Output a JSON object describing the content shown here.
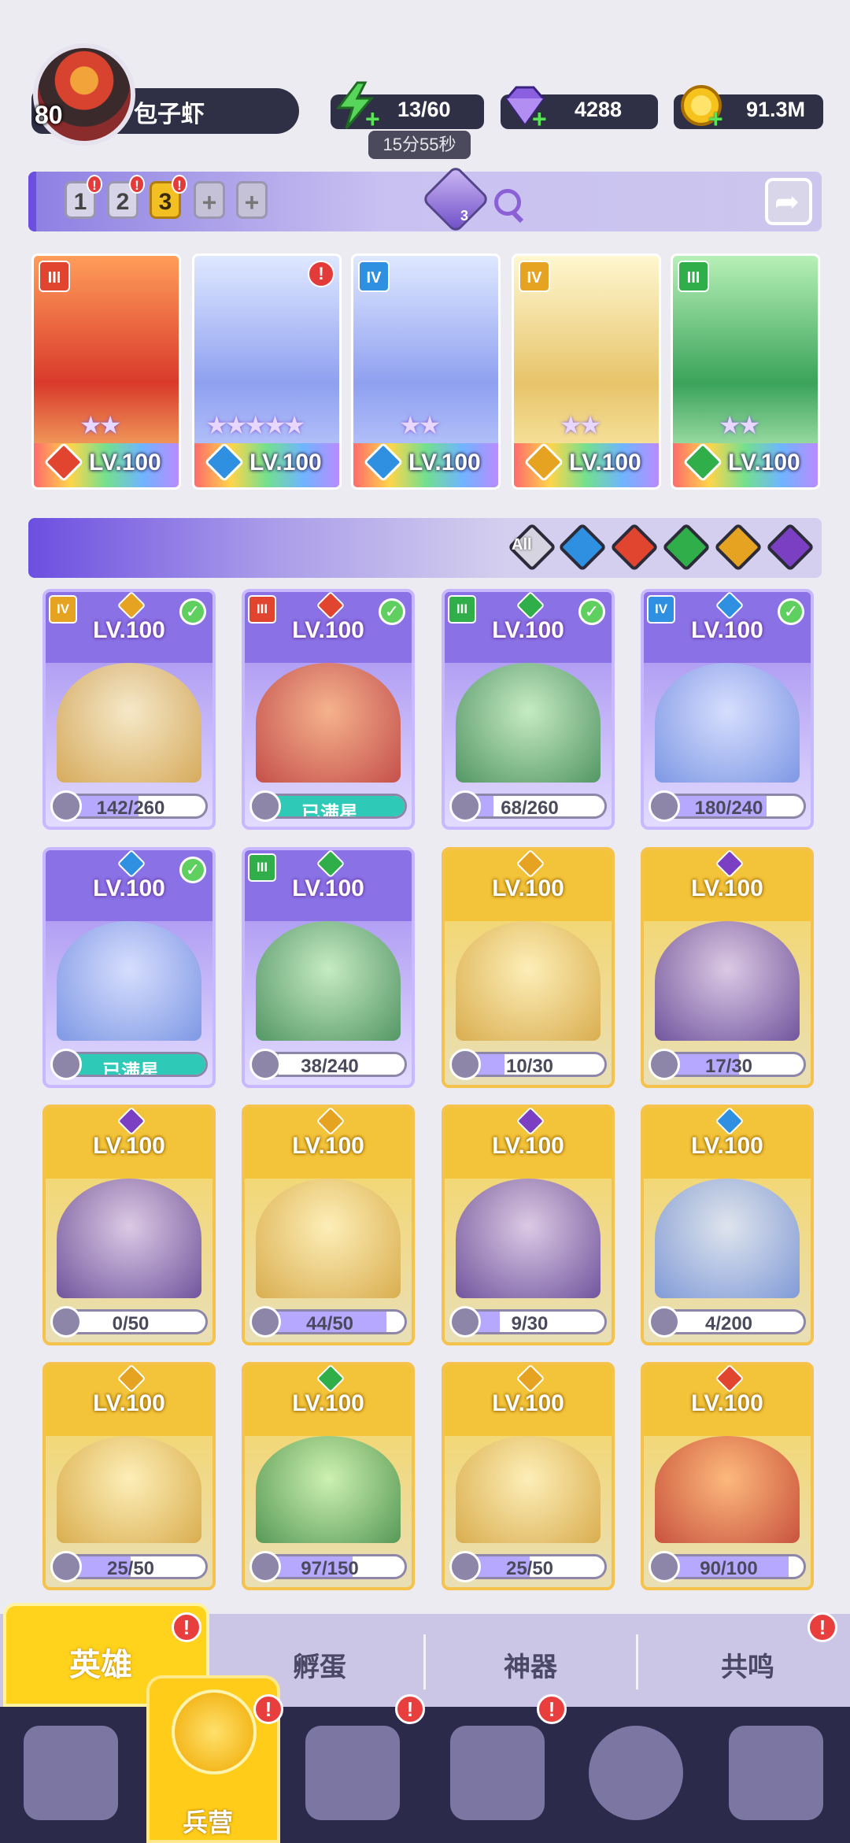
{
  "player": {
    "level": "80",
    "name": "包子虾"
  },
  "resources": {
    "energy": "13/60",
    "energy_timer": "15分55秒",
    "gems": "4288",
    "gold": "91.3M"
  },
  "team_slots": [
    "1",
    "2",
    "3",
    "+",
    "+"
  ],
  "team_diamond_count": "3",
  "team_heroes": [
    {
      "rank": "III",
      "element": "fire",
      "level": "LV.100"
    },
    {
      "rank": "",
      "element": "water",
      "level": "LV.100",
      "stars": "★★★★★"
    },
    {
      "rank": "IV",
      "element": "water",
      "level": "LV.100"
    },
    {
      "rank": "IV",
      "element": "light",
      "level": "LV.100"
    },
    {
      "rank": "III",
      "element": "nature",
      "level": "LV.100"
    }
  ],
  "filter": {
    "all_label": "All"
  },
  "heroes": [
    {
      "rank": "IV",
      "element": "light",
      "level": "LV.100",
      "check": true,
      "progress": "142/260",
      "fill": 0.55,
      "card": "purple"
    },
    {
      "rank": "III",
      "element": "fire",
      "level": "LV.100",
      "check": true,
      "progress": "已满星",
      "fill": 1,
      "card": "purple",
      "full": true
    },
    {
      "rank": "III",
      "element": "nature",
      "level": "LV.100",
      "check": true,
      "progress": "68/260",
      "fill": 0.26,
      "card": "purple"
    },
    {
      "rank": "IV",
      "element": "water",
      "level": "LV.100",
      "check": true,
      "progress": "180/240",
      "fill": 0.75,
      "card": "purple"
    },
    {
      "rank": "",
      "element": "water",
      "level": "LV.100",
      "check": true,
      "progress": "已满星",
      "fill": 1,
      "card": "purple",
      "full": true
    },
    {
      "rank": "III",
      "element": "nature",
      "level": "LV.100",
      "check": false,
      "progress": "38/240",
      "fill": 0.16,
      "card": "purple"
    },
    {
      "rank": "",
      "element": "light",
      "level": "LV.100",
      "check": false,
      "progress": "10/30",
      "fill": 0.33,
      "card": "gold"
    },
    {
      "rank": "",
      "element": "dark",
      "level": "LV.100",
      "check": false,
      "progress": "17/30",
      "fill": 0.57,
      "card": "gold"
    },
    {
      "rank": "",
      "element": "dark",
      "level": "LV.100",
      "check": false,
      "progress": "0/50",
      "fill": 0,
      "card": "gold"
    },
    {
      "rank": "",
      "element": "light",
      "level": "LV.100",
      "check": false,
      "progress": "44/50",
      "fill": 0.88,
      "card": "gold"
    },
    {
      "rank": "",
      "element": "dark",
      "level": "LV.100",
      "check": false,
      "progress": "9/30",
      "fill": 0.3,
      "card": "gold"
    },
    {
      "rank": "",
      "element": "water",
      "level": "LV.100",
      "check": false,
      "progress": "4/200",
      "fill": 0.02,
      "card": "gold"
    },
    {
      "rank": "",
      "element": "light",
      "level": "LV.100",
      "check": false,
      "progress": "25/50",
      "fill": 0.5,
      "card": "gold"
    },
    {
      "rank": "",
      "element": "nature",
      "level": "LV.100",
      "check": false,
      "progress": "97/150",
      "fill": 0.65,
      "card": "gold"
    },
    {
      "rank": "",
      "element": "light",
      "level": "LV.100",
      "check": false,
      "progress": "25/50",
      "fill": 0.5,
      "card": "gold"
    },
    {
      "rank": "",
      "element": "fire",
      "level": "LV.100",
      "check": false,
      "progress": "90/100",
      "fill": 0.9,
      "card": "gold"
    }
  ],
  "tabs": [
    "英雄",
    "孵蛋",
    "神器",
    "共鸣"
  ],
  "nav": {
    "active_label": "兵营"
  },
  "colors": {
    "fire": "#e2452f",
    "water": "#2f8fe0",
    "nature": "#2fae4a",
    "light": "#e6a321",
    "dark": "#7b3fc4",
    "purple_card": "#8a72e6",
    "gold_card": "#f3c43a"
  }
}
